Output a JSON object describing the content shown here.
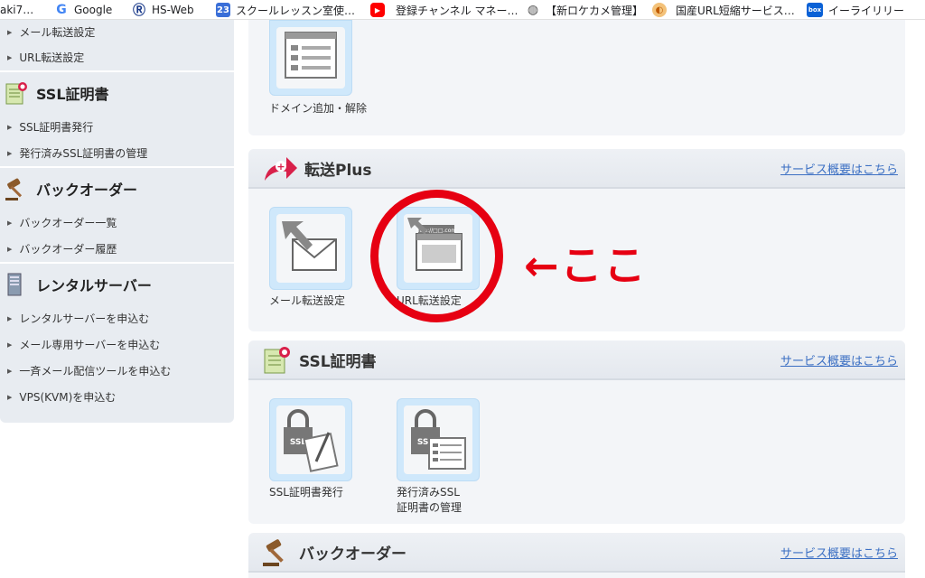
{
  "bookmarks": [
    {
      "label": "aki7…",
      "icon": ""
    },
    {
      "label": "Google",
      "icon": "google-icon"
    },
    {
      "label": "HS-Web",
      "icon": "r-logo-icon"
    },
    {
      "label": "スクールレッスン室使…",
      "icon": "calendar-23-icon"
    },
    {
      "label": "登録チャンネル マネー…",
      "icon": "youtube-icon"
    },
    {
      "label": "【新ロケカメ管理】",
      "icon": "globe-icon"
    },
    {
      "label": "国産URL短縮サービス…",
      "icon": "character-icon"
    },
    {
      "label": "イーライリリー",
      "icon": "box-icon"
    }
  ],
  "calendar_day": "23",
  "sidebar": {
    "top_items": [
      "メール転送設定",
      "URL転送設定"
    ],
    "sections": [
      {
        "title": "SSL証明書",
        "items": [
          "SSL証明書発行",
          "発行済みSSL証明書の管理"
        ]
      },
      {
        "title": "バックオーダー",
        "items": [
          "バックオーダー一覧",
          "バックオーダー履歴"
        ]
      },
      {
        "title": "レンタルサーバー",
        "items": [
          "レンタルサーバーを申込む",
          "メール専用サーバーを申込む",
          "一斉メール配信ツールを申込む",
          "VPS(KVM)を申込む"
        ]
      }
    ]
  },
  "main": {
    "domain_tile_label": "ドメイン追加・解除",
    "tenso": {
      "title": "転送Plus",
      "link": "サービス概要はこちら",
      "tiles": [
        "メール転送設定",
        "URL転送設定"
      ],
      "url_hint": "http://□□.com"
    },
    "ssl": {
      "title": "SSL証明書",
      "link": "サービス概要はこちら",
      "tiles": [
        "SSL証明書発行",
        "発行済みSSL\n証明書の管理"
      ],
      "ssl_badge": "SSL"
    },
    "backorder": {
      "title": "バックオーダー",
      "link": "サービス概要はこちら"
    }
  },
  "annotation": "←ここ",
  "colors": {
    "annotation_red": "#e60012",
    "link_blue": "#3b6fc3",
    "tile_blue": "#cfe8fb"
  }
}
